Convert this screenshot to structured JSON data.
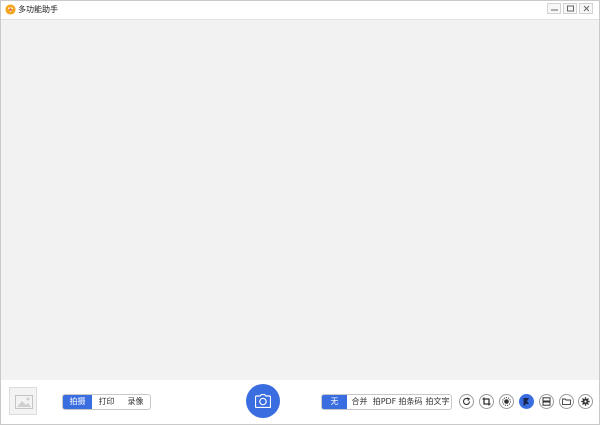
{
  "window": {
    "title": "多功能助手",
    "accent_color": "#3a6ee0",
    "controls": [
      "minimize-icon",
      "maximize-icon",
      "close-icon"
    ]
  },
  "capture_modes": {
    "items": [
      "拍摄",
      "打印",
      "录像"
    ],
    "selected": "拍摄"
  },
  "merge_options": {
    "items": [
      "无",
      "合并",
      "拍PDF",
      "拍条码",
      "拍文字"
    ],
    "selected": "无"
  },
  "tools": [
    "rotate-icon",
    "crop-icon",
    "brightness-icon",
    "color-mode-icon",
    "dual-page-icon",
    "folder-icon",
    "settings-icon"
  ]
}
